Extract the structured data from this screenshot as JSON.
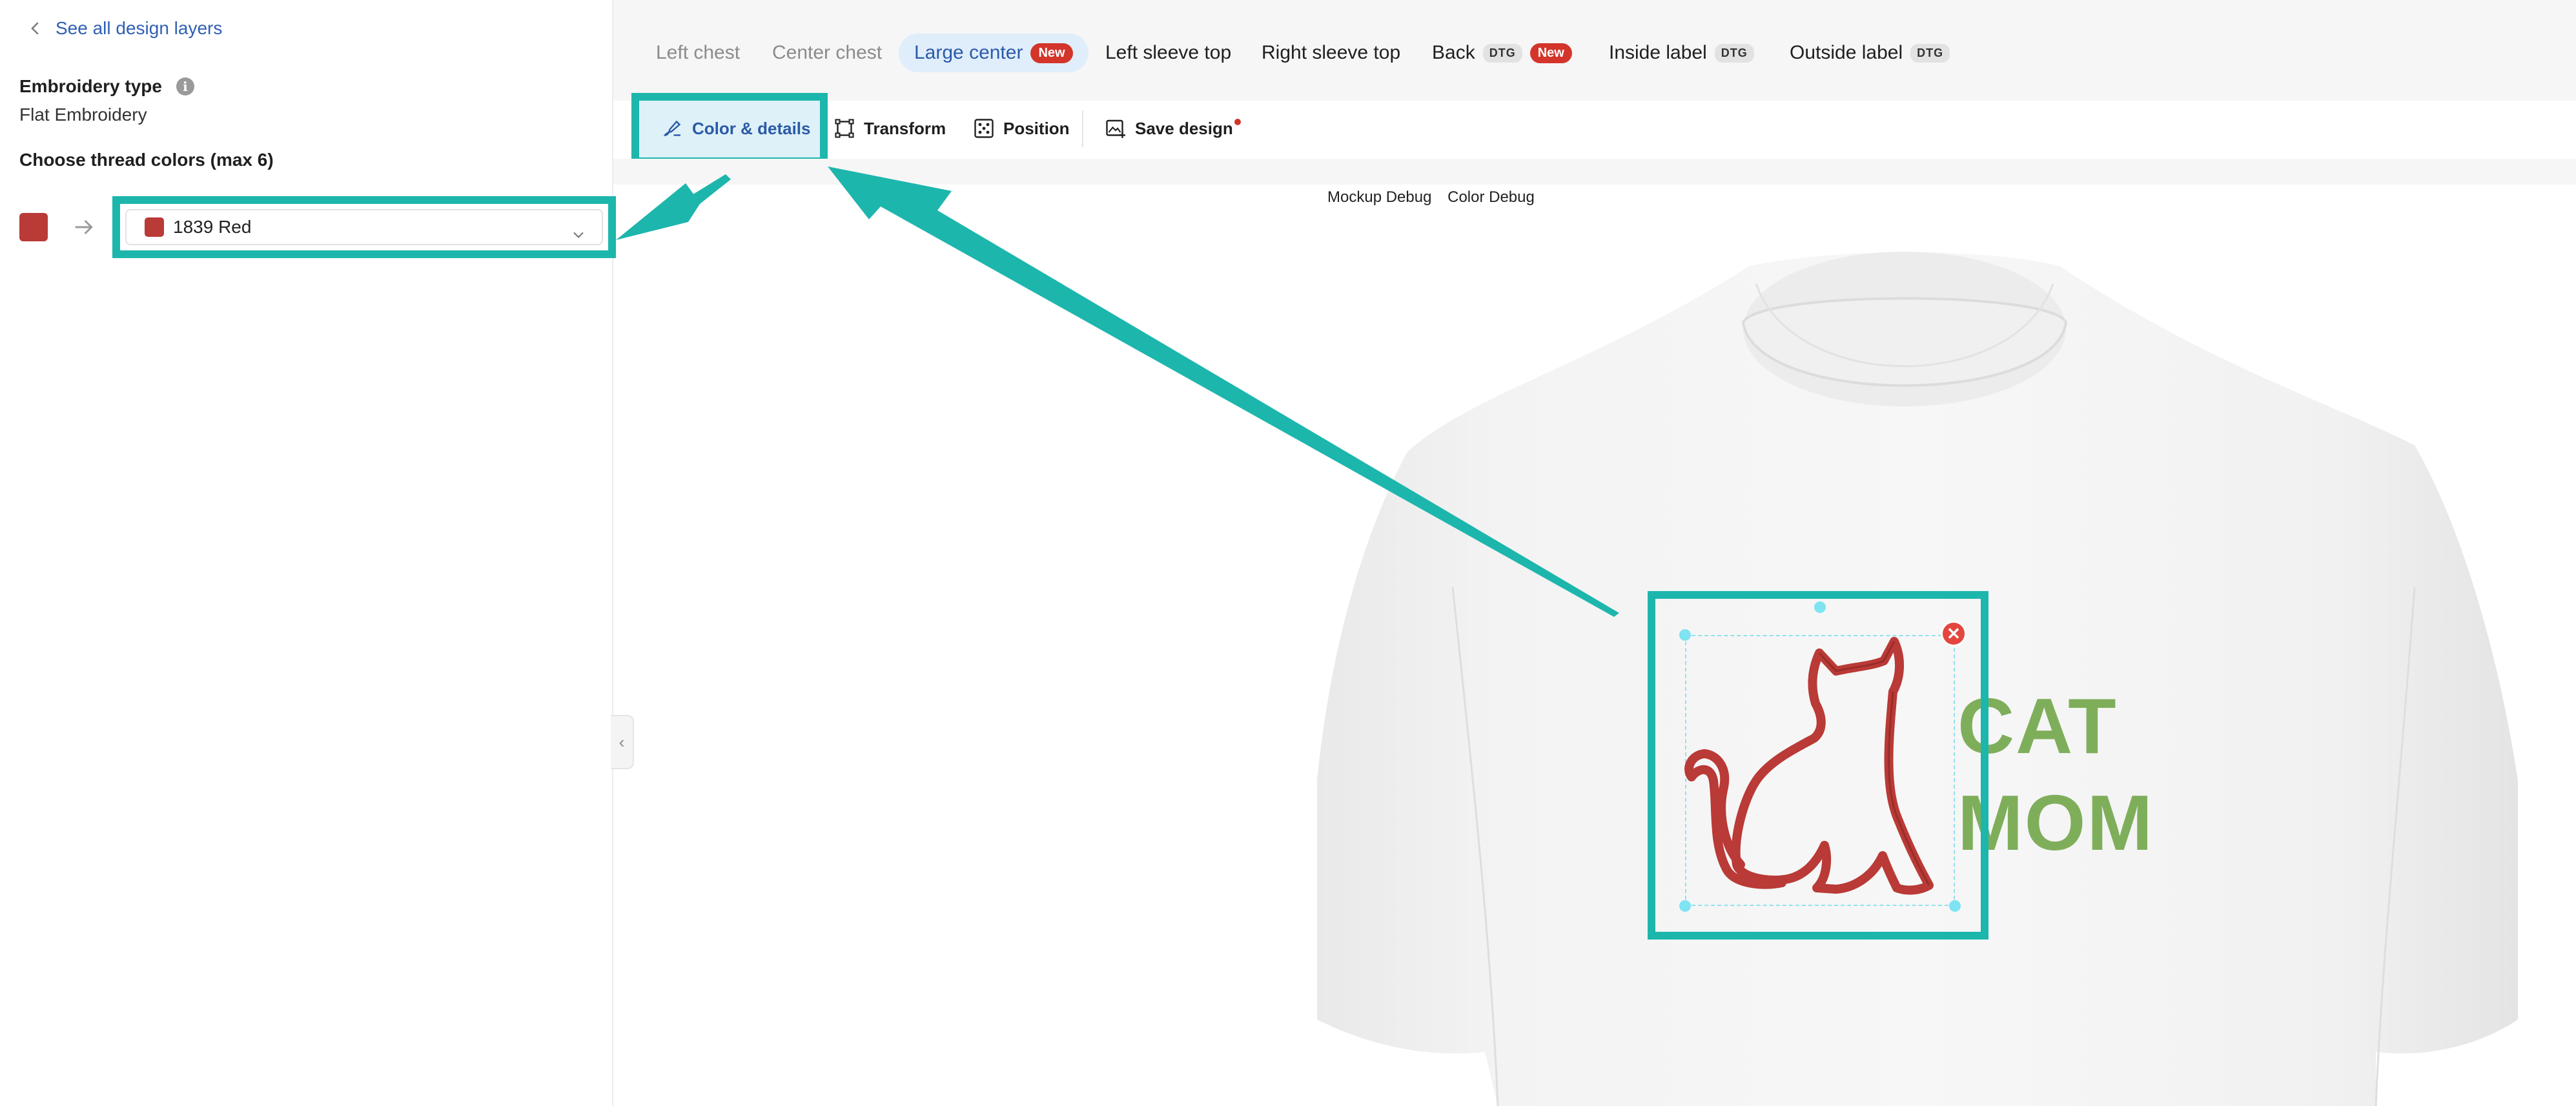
{
  "sidebar": {
    "back_label": "See all design layers",
    "embroidery_type_label": "Embroidery type",
    "embroidery_type_value": "Flat Embroidery",
    "threads_title": "Choose thread colors (max 6)",
    "thread": {
      "color": "#b93a36",
      "selected_label": "1839 Red"
    }
  },
  "tabs": [
    {
      "label": "Left chest",
      "state": "muted",
      "badges": []
    },
    {
      "label": "Center chest",
      "state": "muted",
      "badges": []
    },
    {
      "label": "Large center",
      "state": "active",
      "badges": [
        "New"
      ]
    },
    {
      "label": "Left sleeve top",
      "state": "normal",
      "badges": []
    },
    {
      "label": "Right sleeve top",
      "state": "normal",
      "badges": []
    },
    {
      "label": "Back",
      "state": "normal",
      "badges": [
        "DTG",
        "New"
      ]
    },
    {
      "label": "Inside label",
      "state": "normal",
      "badges": [
        "DTG"
      ]
    },
    {
      "label": "Outside label",
      "state": "normal",
      "badges": [
        "DTG"
      ]
    }
  ],
  "toolbar": {
    "color_details": "Color & details",
    "transform": "Transform",
    "position": "Position",
    "save_design": "Save design"
  },
  "debug": {
    "mockup": "Mockup Debug",
    "color": "Color Debug"
  },
  "design": {
    "line1": "CAT",
    "line2": "MOM",
    "text_color": "#7fae5b",
    "cat_color": "#b93a36"
  },
  "colors": {
    "highlight": "#1db6ad",
    "accent": "#2b5aa8",
    "badge_new": "#d3352b"
  }
}
